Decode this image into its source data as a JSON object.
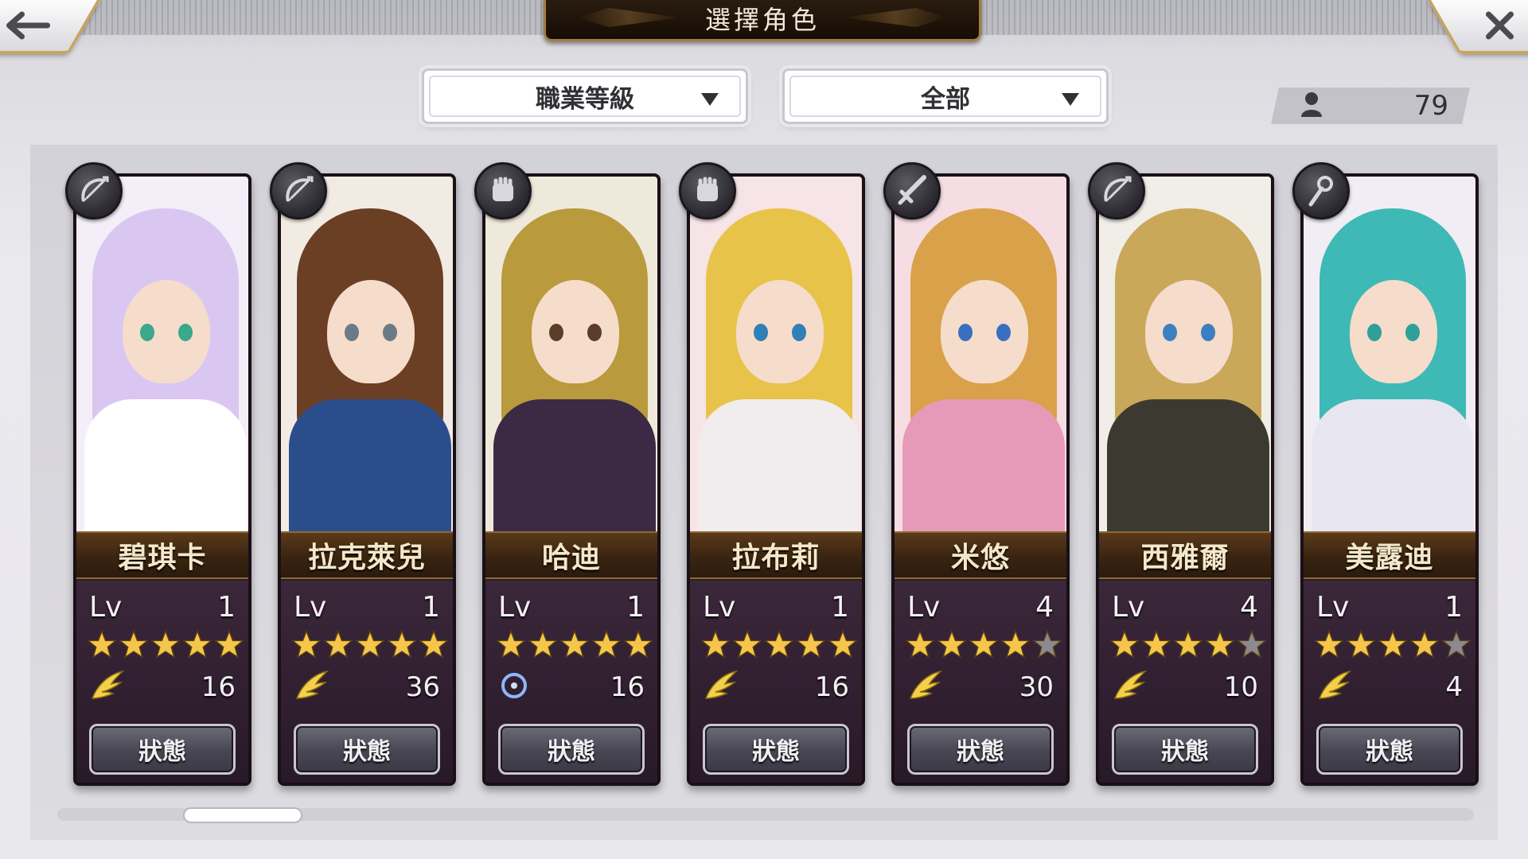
{
  "header": {
    "title": "選擇角色",
    "back_icon": "arrow-left-icon",
    "close_icon": "close-icon"
  },
  "filters": {
    "job_level": "職業等級",
    "category": "全部"
  },
  "roster": {
    "count": "79",
    "icon": "user-icon"
  },
  "status_label": "狀態",
  "lv_label": "Lv",
  "colors": {
    "star_on": "#f5c64a",
    "star_off": "#8c8a90",
    "nameplate": "#3a2410",
    "gold_border": "#c9a45c"
  },
  "scroll": {
    "position_fraction": 0.1
  },
  "characters": [
    {
      "name": "碧琪卡",
      "level": "1",
      "stars": 5,
      "attr_icon": "wing-icon",
      "attr_value": "16",
      "class_icon": "bow-icon"
    },
    {
      "name": "拉克萊兒",
      "level": "1",
      "stars": 5,
      "attr_icon": "wing-icon",
      "attr_value": "36",
      "class_icon": "bow-icon"
    },
    {
      "name": "哈迪",
      "level": "1",
      "stars": 5,
      "attr_icon": "swirl-icon",
      "attr_value": "16",
      "class_icon": "fist-icon"
    },
    {
      "name": "拉布莉",
      "level": "1",
      "stars": 5,
      "attr_icon": "wing-icon",
      "attr_value": "16",
      "class_icon": "fist-icon"
    },
    {
      "name": "米悠",
      "level": "4",
      "stars": 4,
      "attr_icon": "wing-icon",
      "attr_value": "30",
      "class_icon": "sword-icon"
    },
    {
      "name": "西雅爾",
      "level": "4",
      "stars": 4,
      "attr_icon": "wing-icon",
      "attr_value": "10",
      "class_icon": "bow-icon"
    },
    {
      "name": "美露迪",
      "level": "1",
      "stars": 4,
      "attr_icon": "wing-icon",
      "attr_value": "4",
      "class_icon": "staff-icon"
    }
  ]
}
